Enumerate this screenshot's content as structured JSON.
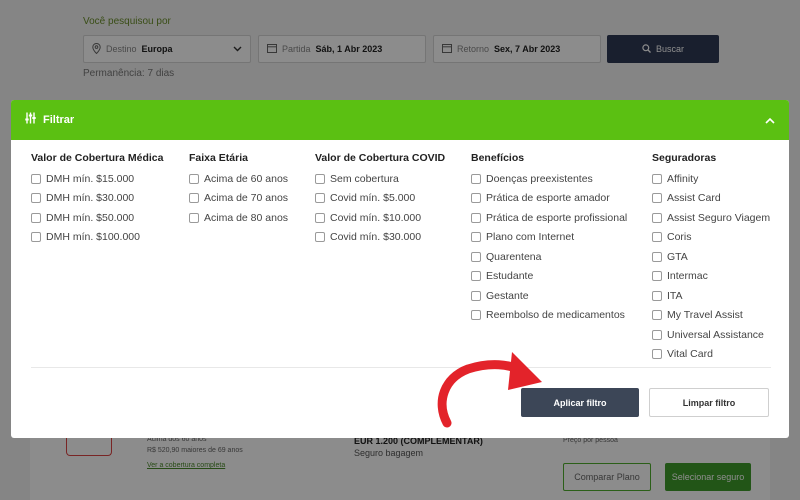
{
  "search": {
    "label": "Você pesquisou por",
    "destination_prefix": "Destino",
    "destination_value": "Europa",
    "departure_prefix": "Partida",
    "departure_value": "Sáb, 1 Abr 2023",
    "return_prefix": "Retorno",
    "return_value": "Sex, 7 Abr 2023",
    "button_label": "Buscar",
    "stay": "Permanência: 7 dias"
  },
  "result": {
    "note1": "Acima dos 60 anos",
    "note2": "R$ 520,90 maiores de 69 anos",
    "link": "Ver a cobertura completa",
    "coverage": "EUR 1.200 (COMPLEMENTAR)",
    "coverage_sub": "Seguro bagagem",
    "price_note": "Preço por pessoa",
    "compare_label": "Comparar Plano",
    "select_label": "Selecionar seguro"
  },
  "filter": {
    "title": "Filtrar",
    "columns": [
      {
        "title": "Valor de Cobertura Médica",
        "options": [
          "DMH mín. $15.000",
          "DMH mín. $30.000",
          "DMH mín. $50.000",
          "DMH mín. $100.000"
        ]
      },
      {
        "title": "Faixa Etária",
        "options": [
          "Acima de 60 anos",
          "Acima de 70 anos",
          "Acima de 80 anos"
        ]
      },
      {
        "title": "Valor de Cobertura COVID",
        "options": [
          "Sem cobertura",
          "Covid mín. $5.000",
          "Covid mín. $10.000",
          "Covid mín. $30.000"
        ]
      },
      {
        "title": "Benefícios",
        "options": [
          "Doenças preexistentes",
          "Prática de esporte amador",
          "Prática de esporte profissional",
          "Plano com Internet",
          "Quarentena",
          "Estudante",
          "Gestante",
          "Reembolso de medicamentos"
        ]
      },
      {
        "title": "Seguradoras",
        "options": [
          "Affinity",
          "Assist Card",
          "Assist Seguro Viagem",
          "Coris",
          "GTA",
          "Intermac",
          "ITA",
          "My Travel Assist",
          "Universal Assistance",
          "Vital Card"
        ]
      }
    ],
    "apply_label": "Aplicar filtro",
    "clear_label": "Limpar filtro"
  },
  "colors": {
    "header_green": "#5bc012",
    "apply_dark": "#3c4657",
    "arrow_red": "#e3232a"
  }
}
